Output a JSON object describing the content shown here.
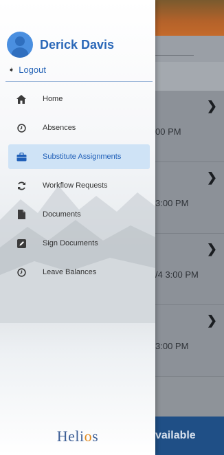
{
  "background": {
    "times": [
      "00 PM",
      "3:00 PM",
      "/4 3:00 PM",
      "3:00 PM"
    ],
    "bottom_button": "vailable"
  },
  "drawer": {
    "user_name": "Derick Davis",
    "logout_label": "Logout",
    "menu": [
      {
        "label": "Home",
        "icon": "home-icon"
      },
      {
        "label": "Absences",
        "icon": "clock-icon"
      },
      {
        "label": "Substitute Assignments",
        "icon": "briefcase-icon",
        "active": true
      },
      {
        "label": "Workflow Requests",
        "icon": "refresh-icon"
      },
      {
        "label": "Documents",
        "icon": "document-icon"
      },
      {
        "label": "Sign Documents",
        "icon": "edit-icon"
      },
      {
        "label": "Leave Balances",
        "icon": "clock-icon"
      }
    ],
    "footer_logo": {
      "prefix": "Heli",
      "accent": "o",
      "suffix": "s"
    }
  },
  "colors": {
    "accent": "#2a67b8",
    "active_bg": "#cfe3f6",
    "logo_orange": "#e08a1e"
  }
}
